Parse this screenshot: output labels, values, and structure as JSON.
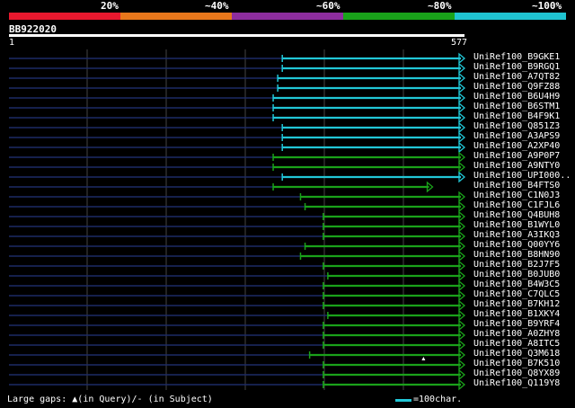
{
  "legend": {
    "labels": [
      "20%",
      "~40%",
      "~60%",
      "~80%",
      "~100%"
    ],
    "colors": [
      "#e8182e",
      "#e8771b",
      "#8d2d9e",
      "#19a21a",
      "#1fc3d1"
    ]
  },
  "query": {
    "name": "BB922020",
    "start": "1",
    "end": "577",
    "length": 577
  },
  "hits": [
    {
      "name": "UniRef100_B9GKE1",
      "start": 0.6,
      "color": "#21c6d6",
      "ends_at_right": true
    },
    {
      "name": "UniRef100_B9RGQ1",
      "start": 0.6,
      "color": "#21c6d6",
      "ends_at_right": true
    },
    {
      "name": "UniRef100_A7QT82",
      "start": 0.59,
      "color": "#21c6d6",
      "ends_at_right": true
    },
    {
      "name": "UniRef100_Q9FZ88",
      "start": 0.59,
      "color": "#21c6d6",
      "ends_at_right": true
    },
    {
      "name": "UniRef100_B6U4H9",
      "start": 0.58,
      "color": "#21c6d6",
      "ends_at_right": true
    },
    {
      "name": "UniRef100_B6STM1",
      "start": 0.58,
      "color": "#21c6d6",
      "ends_at_right": true
    },
    {
      "name": "UniRef100_B4F9K1",
      "start": 0.58,
      "color": "#21c6d6",
      "ends_at_right": true
    },
    {
      "name": "UniRef100_Q851Z3",
      "start": 0.6,
      "color": "#21c6d6",
      "ends_at_right": true
    },
    {
      "name": "UniRef100_A3APS9",
      "start": 0.6,
      "color": "#21c6d6",
      "ends_at_right": true
    },
    {
      "name": "UniRef100_A2XP40",
      "start": 0.6,
      "color": "#21c6d6",
      "ends_at_right": true
    },
    {
      "name": "UniRef100_A9P0P7",
      "start": 0.58,
      "color": "#1aa11a",
      "ends_at_right": true
    },
    {
      "name": "UniRef100_A9NTY0",
      "start": 0.58,
      "color": "#1aa11a",
      "ends_at_right": true
    },
    {
      "name": "UniRef100_UPI000..",
      "start": 0.6,
      "color": "#21c6d6",
      "ends_at_right": true
    },
    {
      "name": "UniRef100_B4FTS0",
      "start": 0.58,
      "color": "#1aa11a",
      "ends_at_right": false,
      "end": 0.93
    },
    {
      "name": "UniRef100_C1N0J3",
      "start": 0.64,
      "color": "#1aa11a",
      "ends_at_right": true
    },
    {
      "name": "UniRef100_C1FJL6",
      "start": 0.65,
      "color": "#1aa11a",
      "ends_at_right": true
    },
    {
      "name": "UniRef100_Q4BUH8",
      "start": 0.69,
      "color": "#1aa11a",
      "ends_at_right": true
    },
    {
      "name": "UniRef100_B1WYL0",
      "start": 0.69,
      "color": "#1aa11a",
      "ends_at_right": true
    },
    {
      "name": "UniRef100_A3IKQ3",
      "start": 0.69,
      "color": "#1aa11a",
      "ends_at_right": true
    },
    {
      "name": "UniRef100_Q00YY6",
      "start": 0.65,
      "color": "#1aa11a",
      "ends_at_right": true
    },
    {
      "name": "UniRef100_B8HN90",
      "start": 0.64,
      "color": "#1aa11a",
      "ends_at_right": true
    },
    {
      "name": "UniRef100_B2J7F5",
      "start": 0.69,
      "color": "#1aa11a",
      "ends_at_right": true
    },
    {
      "name": "UniRef100_B0JUB0",
      "start": 0.7,
      "color": "#1aa11a",
      "ends_at_right": true
    },
    {
      "name": "UniRef100_B4W3C5",
      "start": 0.69,
      "color": "#1aa11a",
      "ends_at_right": true
    },
    {
      "name": "UniRef100_C7QLC5",
      "start": 0.69,
      "color": "#1aa11a",
      "ends_at_right": true
    },
    {
      "name": "UniRef100_B7KH12",
      "start": 0.69,
      "color": "#1aa11a",
      "ends_at_right": true
    },
    {
      "name": "UniRef100_B1XKY4",
      "start": 0.7,
      "color": "#1aa11a",
      "ends_at_right": true
    },
    {
      "name": "UniRef100_B9YRF4",
      "start": 0.69,
      "color": "#1aa11a",
      "ends_at_right": true
    },
    {
      "name": "UniRef100_A0ZHY8",
      "start": 0.69,
      "color": "#1aa11a",
      "ends_at_right": true
    },
    {
      "name": "UniRef100_A8ITC5",
      "start": 0.69,
      "color": "#1aa11a",
      "ends_at_right": true
    },
    {
      "name": "UniRef100_Q3M618",
      "start": 0.66,
      "color": "#1aa11a",
      "ends_at_right": true,
      "gap_marker": 0.91
    },
    {
      "name": "UniRef100_B7K510",
      "start": 0.69,
      "color": "#1aa11a",
      "ends_at_right": true
    },
    {
      "name": "UniRef100_Q8YX89",
      "start": 0.69,
      "color": "#1aa11a",
      "ends_at_right": true
    },
    {
      "name": "UniRef100_Q119Y8",
      "start": 0.69,
      "color": "#1aa11a",
      "ends_at_right": true
    }
  ],
  "footer": {
    "gaps_label": "Large gaps:",
    "query_gap": "(in Query)/",
    "subject_gap": "- (in Subject)",
    "scale_label": "=100char."
  }
}
